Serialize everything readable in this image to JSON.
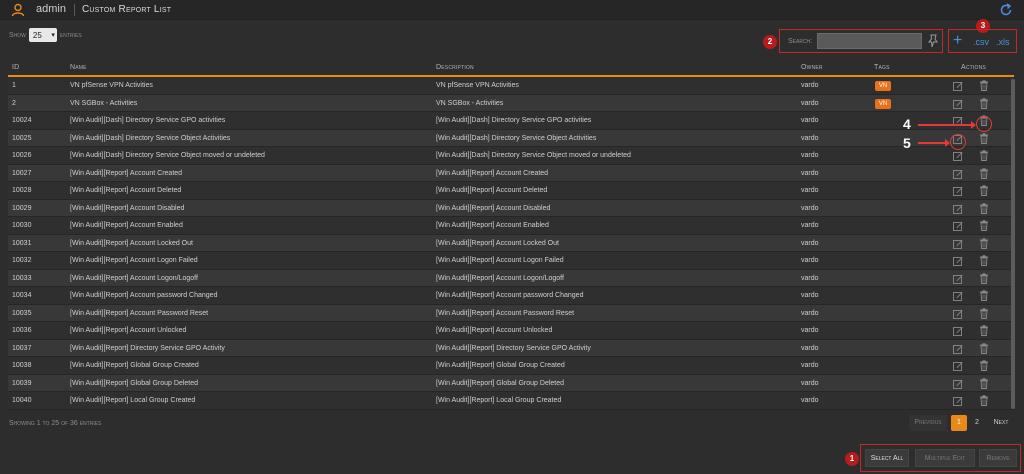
{
  "header": {
    "user": "admin",
    "title": "Custom Report List",
    "icons": [
      "user-icon",
      "refresh-icon"
    ],
    "accent": "#e8891a"
  },
  "length": {
    "show": "Show",
    "value": "25",
    "entries": "entries"
  },
  "search": {
    "label": "Search:",
    "value": ""
  },
  "export": {
    "add": "+",
    "csv": ".csv",
    "xls": ".xls"
  },
  "callouts": {
    "b1": "1",
    "b2": "2",
    "b3": "3",
    "c4": "4",
    "c5": "5",
    "badge_color": "#b71c1c"
  },
  "table": {
    "columns": [
      "ID",
      "Name",
      "Description",
      "Owner",
      "Tags",
      "Actions"
    ],
    "rows": [
      {
        "id": "1",
        "name": "VN pfSense VPN Activities",
        "description": "VN pfSense VPN Activities",
        "owner": "vardo",
        "tag": "VN"
      },
      {
        "id": "2",
        "name": "VN SGBox - Activities",
        "description": "VN SGBox - Activities",
        "owner": "vardo",
        "tag": "VN"
      },
      {
        "id": "10024",
        "name": "[Win Audit][Dash] Directory Service GPO activities",
        "description": "[Win Audit][Dash] Directory Service GPO activities",
        "owner": "vardo",
        "tag": ""
      },
      {
        "id": "10025",
        "name": "[Win Audit][Dash] Directory Service Object Activities",
        "description": "[Win Audit][Dash] Directory Service Object Activities",
        "owner": "vardo",
        "tag": ""
      },
      {
        "id": "10026",
        "name": "[Win Audit][Dash] Directory Service Object moved or undeleted",
        "description": "[Win Audit][Dash] Directory Service Object moved or undeleted",
        "owner": "vardo",
        "tag": ""
      },
      {
        "id": "10027",
        "name": "[Win Audit][Report] Account Created",
        "description": "[Win Audit][Report] Account Created",
        "owner": "vardo",
        "tag": ""
      },
      {
        "id": "10028",
        "name": "[Win Audit][Report] Account Deleted",
        "description": "[Win Audit][Report] Account Deleted",
        "owner": "vardo",
        "tag": ""
      },
      {
        "id": "10029",
        "name": "[Win Audit][Report] Account Disabled",
        "description": "[Win Audit][Report] Account Disabled",
        "owner": "vardo",
        "tag": ""
      },
      {
        "id": "10030",
        "name": "[Win Audit][Report] Account Enabled",
        "description": "[Win Audit][Report] Account Enabled",
        "owner": "vardo",
        "tag": ""
      },
      {
        "id": "10031",
        "name": "[Win Audit][Report] Account Locked Out",
        "description": "[Win Audit][Report] Account Locked Out",
        "owner": "vardo",
        "tag": ""
      },
      {
        "id": "10032",
        "name": "[Win Audit][Report] Account Logon Failed",
        "description": "[Win Audit][Report] Account Logon Failed",
        "owner": "vardo",
        "tag": ""
      },
      {
        "id": "10033",
        "name": "[Win Audit][Report] Account Logon/Logoff",
        "description": "[Win Audit][Report] Account Logon/Logoff",
        "owner": "vardo",
        "tag": ""
      },
      {
        "id": "10034",
        "name": "[Win Audit][Report] Account password Changed",
        "description": "[Win Audit][Report] Account password Changed",
        "owner": "vardo",
        "tag": ""
      },
      {
        "id": "10035",
        "name": "[Win Audit][Report] Account Password Reset",
        "description": "[Win Audit][Report] Account Password Reset",
        "owner": "vardo",
        "tag": ""
      },
      {
        "id": "10036",
        "name": "[Win Audit][Report] Account Unlocked",
        "description": "[Win Audit][Report] Account Unlocked",
        "owner": "vardo",
        "tag": ""
      },
      {
        "id": "10037",
        "name": "[Win Audit][Report] Directory Service GPO Activity",
        "description": "[Win Audit][Report] Directory Service GPO Activity",
        "owner": "vardo",
        "tag": ""
      },
      {
        "id": "10038",
        "name": "[Win Audit][Report] Global Group Created",
        "description": "[Win Audit][Report] Global Group Created",
        "owner": "vardo",
        "tag": ""
      },
      {
        "id": "10039",
        "name": "[Win Audit][Report] Global Group Deleted",
        "description": "[Win Audit][Report] Global Group Deleted",
        "owner": "vardo",
        "tag": ""
      },
      {
        "id": "10040",
        "name": "[Win Audit][Report] Local Group Created",
        "description": "[Win Audit][Report] Local Group Created",
        "owner": "vardo",
        "tag": ""
      }
    ]
  },
  "footer": {
    "showing": "Showing 1 to 25 of 36 entries",
    "previous": "Previous",
    "page1": "1",
    "page2": "2",
    "next": "Next"
  },
  "actions": {
    "select_all": "Select All",
    "multiple_edit": "Multiple Edit",
    "remove": "Remove"
  }
}
